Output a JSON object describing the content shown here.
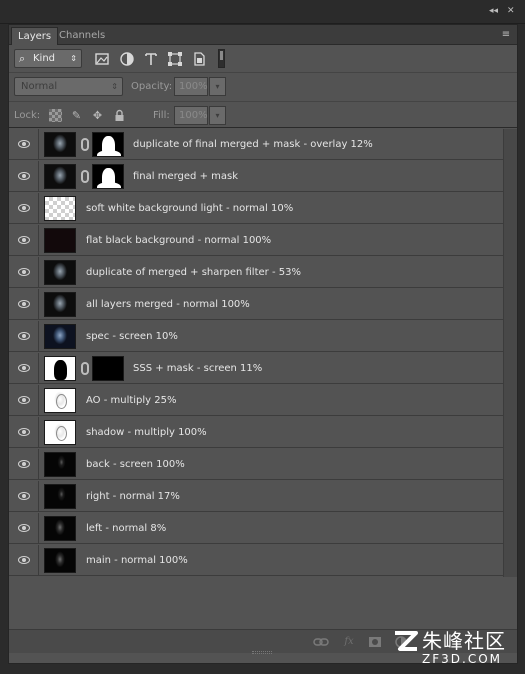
{
  "window": {
    "collapse_glyph": "◂◂",
    "close_glyph": "✕"
  },
  "tabs": [
    {
      "label": "Layers",
      "active": true
    },
    {
      "label": "Channels",
      "active": false
    }
  ],
  "panel_menu_icon": "panel-menu-icon",
  "filter": {
    "kind_label": "Kind",
    "icons": [
      "pixel-filter-icon",
      "adjustment-filter-icon",
      "type-filter-icon",
      "shape-filter-icon",
      "smart-object-filter-icon"
    ],
    "toggle": "filter-toggle-switch"
  },
  "blend": {
    "mode": "Normal",
    "opacity_label": "Opacity:",
    "opacity_value": "100%"
  },
  "lock": {
    "label": "Lock:",
    "icons": [
      "lock-transparent-icon",
      "lock-paint-icon",
      "lock-move-icon",
      "lock-all-icon"
    ],
    "fill_label": "Fill:",
    "fill_value": "100%"
  },
  "layers": [
    {
      "name": "duplicate of final merged + mask - overlay 12%",
      "thumb": "face",
      "has_mask": true,
      "mask": "white-head",
      "visible": true
    },
    {
      "name": "final merged + mask",
      "thumb": "face",
      "has_mask": true,
      "mask": "white-head",
      "visible": true
    },
    {
      "name": "soft white background light - normal 10%",
      "thumb": "checker",
      "has_mask": false,
      "visible": true
    },
    {
      "name": "flat black background - normal 100%",
      "thumb": "flat-black",
      "has_mask": false,
      "visible": true
    },
    {
      "name": "duplicate of merged + sharpen filter - 53%",
      "thumb": "face",
      "has_mask": false,
      "visible": true
    },
    {
      "name": "all layers merged - normal 100%",
      "thumb": "face",
      "has_mask": false,
      "visible": true
    },
    {
      "name": "spec - screen 10%",
      "thumb": "face-blue",
      "has_mask": false,
      "visible": true
    },
    {
      "name": "SSS + mask - screen 11%",
      "thumb": "black-silhouette",
      "has_mask": true,
      "mask": "black",
      "visible": true
    },
    {
      "name": "AO - multiply 25%",
      "thumb": "white-sketch",
      "has_mask": false,
      "visible": true
    },
    {
      "name": "shadow - multiply 100%",
      "thumb": "white-sketch",
      "has_mask": false,
      "visible": true
    },
    {
      "name": "back - screen 100%",
      "thumb": "face-faint",
      "has_mask": false,
      "visible": true
    },
    {
      "name": "right - normal 17%",
      "thumb": "face-faint",
      "has_mask": false,
      "visible": true
    },
    {
      "name": "left - normal 8%",
      "thumb": "face-dark",
      "has_mask": false,
      "visible": true
    },
    {
      "name": "main - normal 100%",
      "thumb": "face-dark",
      "has_mask": false,
      "visible": true
    }
  ],
  "bottom_icons": [
    "link-layers-icon",
    "fx-icon",
    "add-mask-icon",
    "adjustment-layer-icon",
    "new-group-icon",
    "new-layer-icon",
    "trash-icon"
  ],
  "watermark": {
    "title": "朱峰社区",
    "subtitle": "ZF3D.COM"
  }
}
